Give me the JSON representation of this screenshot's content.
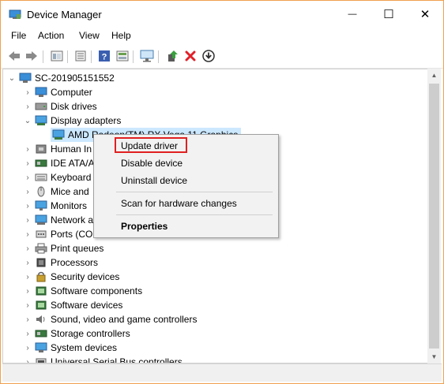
{
  "window": {
    "title": "Device Manager",
    "controls": {
      "minimize": "—",
      "maximize": "☐",
      "close": "✕"
    }
  },
  "menubar": {
    "items": [
      "File",
      "Action",
      "View",
      "Help"
    ]
  },
  "toolbar": {
    "buttons": [
      "back-icon",
      "forward-icon",
      "properties-icon",
      "show-hide-icon",
      "help-icon",
      "device-view-icon",
      "monitor-icon",
      "update-driver-icon",
      "uninstall-icon",
      "download-icon"
    ],
    "uninstall_color": "#e0202a"
  },
  "tree": {
    "root": "SC-201905151552",
    "items": [
      {
        "label": "Computer",
        "expander": "›"
      },
      {
        "label": "Disk drives",
        "expander": "›"
      },
      {
        "label": "Display adapters",
        "expander": "⌄"
      },
      {
        "label": "AMD Radeon(TM) RX Vega 11 Graphics",
        "expander": ""
      },
      {
        "label": "Human In",
        "expander": "›"
      },
      {
        "label": "IDE ATA/A",
        "expander": "›"
      },
      {
        "label": "Keyboard",
        "expander": "›"
      },
      {
        "label": "Mice and",
        "expander": "›"
      },
      {
        "label": "Monitors",
        "expander": "›"
      },
      {
        "label": "Network a",
        "expander": "›"
      },
      {
        "label": "Ports (CO",
        "expander": "›"
      },
      {
        "label": "Print queues",
        "expander": "›"
      },
      {
        "label": "Processors",
        "expander": "›"
      },
      {
        "label": "Security devices",
        "expander": "›"
      },
      {
        "label": "Software components",
        "expander": "›"
      },
      {
        "label": "Software devices",
        "expander": "›"
      },
      {
        "label": "Sound, video and game controllers",
        "expander": "›"
      },
      {
        "label": "Storage controllers",
        "expander": "›"
      },
      {
        "label": "System devices",
        "expander": "›"
      },
      {
        "label": "Universal Serial Bus controllers",
        "expander": "›"
      }
    ]
  },
  "context_menu": {
    "update_driver": "Update driver",
    "disable_device": "Disable device",
    "uninstall_device": "Uninstall device",
    "scan": "Scan for hardware changes",
    "properties": "Properties",
    "highlight_color": "#e02020"
  },
  "colors": {
    "selection": "#cce8ff",
    "window_border": "#f0a050"
  }
}
